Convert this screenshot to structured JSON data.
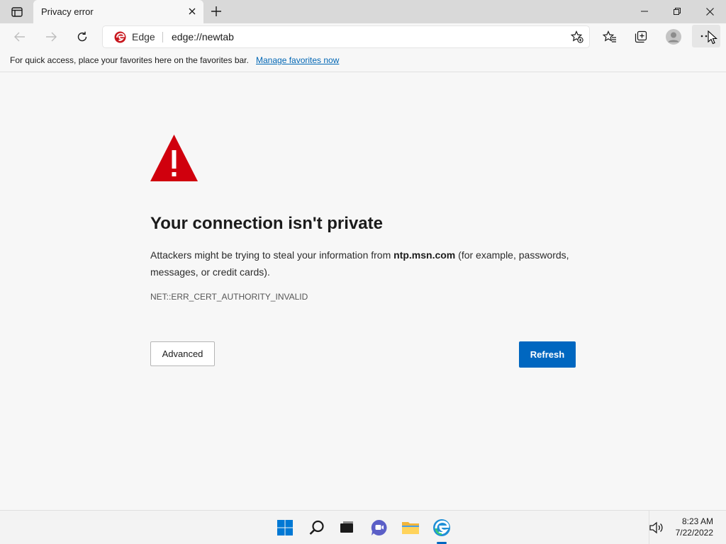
{
  "tab": {
    "title": "Privacy error"
  },
  "address_bar": {
    "site_label": "Edge",
    "url": "edge://newtab"
  },
  "favorites_bar": {
    "text": "For quick access, place your favorites here on the favorites bar.",
    "link": "Manage favorites now"
  },
  "error_page": {
    "heading": "Your connection isn't private",
    "body_prefix": "Attackers might be trying to steal your information from ",
    "domain": "ntp.msn.com",
    "body_suffix": " (for example, passwords, messages, or credit cards).",
    "error_code": "NET::ERR_CERT_AUTHORITY_INVALID",
    "advanced_label": "Advanced",
    "refresh_label": "Refresh"
  },
  "taskbar": {
    "time": "8:23 AM",
    "date": "7/22/2022"
  },
  "colors": {
    "accent": "#0067c0",
    "warning": "#d0000d",
    "link": "#0066b4"
  }
}
